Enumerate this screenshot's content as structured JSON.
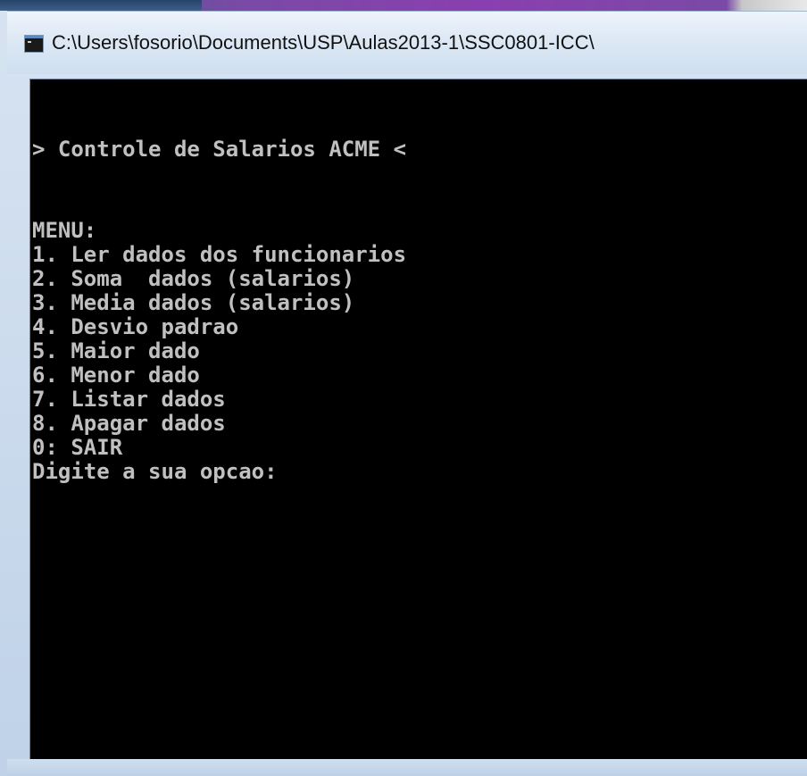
{
  "window": {
    "title": "C:\\Users\\fosorio\\Documents\\USP\\Aulas2013-1\\SSC0801-ICC\\"
  },
  "console": {
    "banner": "> Controle de Salarios ACME <",
    "menu_header": "MENU:",
    "menu_items": [
      "1. Ler dados dos funcionarios",
      "2. Soma  dados (salarios)",
      "3. Media dados (salarios)",
      "4. Desvio padrao",
      "5. Maior dado",
      "6. Menor dado",
      "7. Listar dados",
      "8. Apagar dados",
      "0: SAIR"
    ],
    "prompt": "Digite a sua opcao:"
  },
  "colors": {
    "console_background": "#000000",
    "console_text": "#c0c0c0",
    "titlebar": "#dbe7f4"
  },
  "icons": {
    "app_icon": "console-window-icon"
  }
}
